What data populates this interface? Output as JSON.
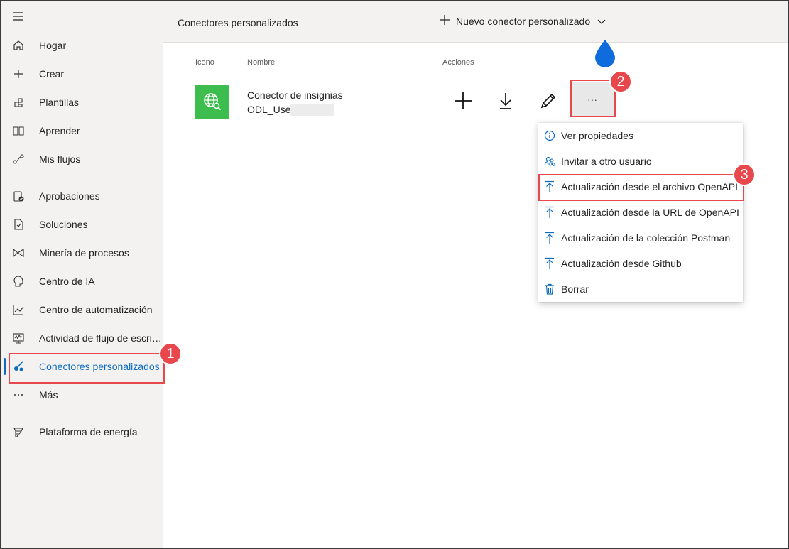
{
  "sidebar": {
    "items": [
      {
        "label": "Hogar",
        "icon": "home-icon"
      },
      {
        "label": "Crear",
        "icon": "plus-icon"
      },
      {
        "label": "Plantillas",
        "icon": "templates-icon"
      },
      {
        "label": "Aprender",
        "icon": "book-icon"
      },
      {
        "label": "Mis flujos",
        "icon": "flows-icon"
      },
      {
        "label": "Aprobaciones",
        "icon": "approvals-icon"
      },
      {
        "label": "Soluciones",
        "icon": "solutions-icon"
      },
      {
        "label": "Minería de procesos",
        "icon": "process-mining-icon"
      },
      {
        "label": "Centro de IA",
        "icon": "ai-hub-icon"
      },
      {
        "label": "Centro de automatización",
        "icon": "automation-center-icon"
      },
      {
        "label": "Actividad de flujo de escritorio",
        "icon": "desktop-flow-icon"
      },
      {
        "label": "Conectores personalizados",
        "icon": "custom-connectors-icon",
        "active": true
      },
      {
        "label": "Más",
        "icon": "more-icon"
      },
      {
        "label": "Plataforma de energía",
        "icon": "power-platform-icon"
      }
    ]
  },
  "header": {
    "title": "Conectores personalizados",
    "new_connector_label": "Nuevo conector personalizado"
  },
  "table": {
    "columns": [
      "Icono",
      "Nombre",
      "Acciones"
    ],
    "rows": [
      {
        "name": "Conector de insignias",
        "owner": "ODL_User"
      }
    ],
    "more_label": "···"
  },
  "menu": {
    "items": [
      {
        "label": "Ver propiedades",
        "icon": "info-icon"
      },
      {
        "label": "Invitar a otro usuario",
        "icon": "invite-user-icon"
      },
      {
        "label": "Actualización desde el archivo OpenAPI",
        "icon": "upload-icon"
      },
      {
        "label": "Actualización desde la URL de OpenAPI",
        "icon": "upload-icon"
      },
      {
        "label": "Actualización de la colección Postman",
        "icon": "upload-icon"
      },
      {
        "label": "Actualización desde Github",
        "icon": "upload-icon"
      },
      {
        "label": "Borrar",
        "icon": "trash-icon"
      }
    ]
  },
  "annotations": {
    "badge1": "1",
    "badge2": "2",
    "badge3": "3"
  },
  "colors": {
    "accent": "#0f6cbd",
    "annotation_red": "#e8474c",
    "connector_green": "#3dbd4e",
    "drop_blue": "#0f6cdc"
  }
}
